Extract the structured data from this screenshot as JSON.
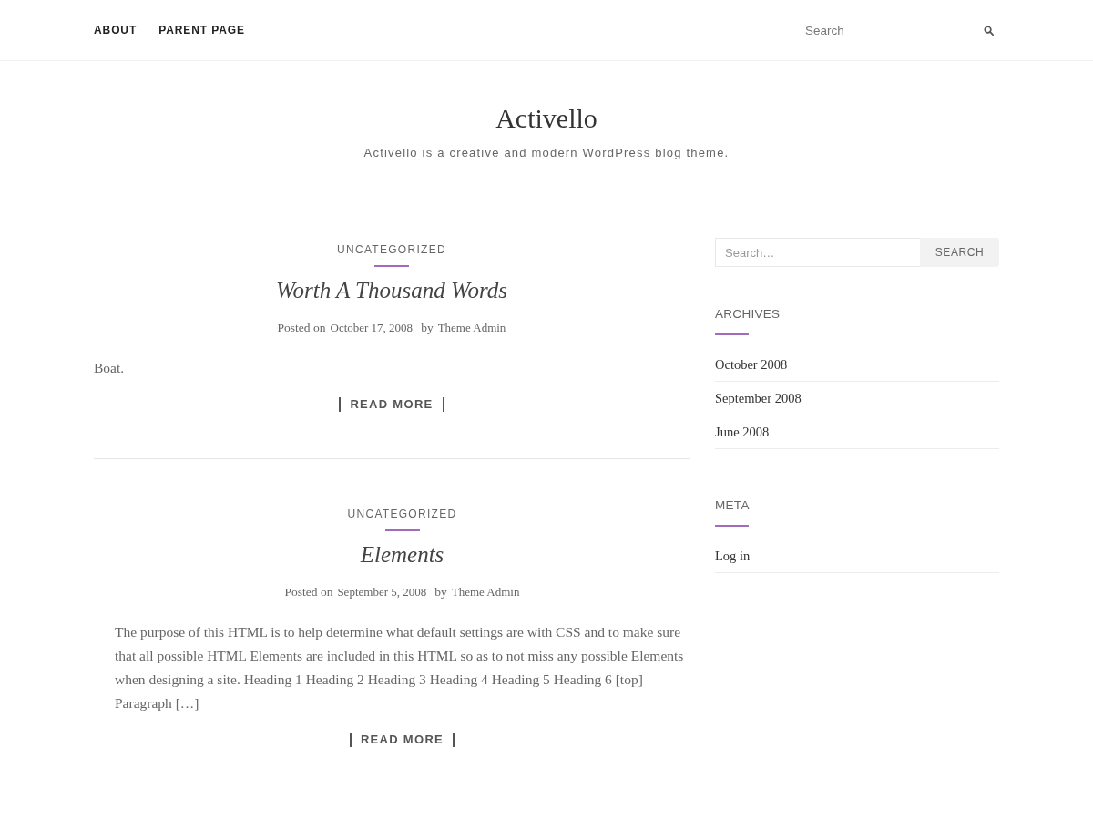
{
  "nav": {
    "items": [
      {
        "label": "ABOUT"
      },
      {
        "label": "PARENT PAGE"
      }
    ],
    "search": {
      "placeholder": "Search"
    }
  },
  "site": {
    "title": "Activello",
    "tagline": "Activello is a creative and modern WordPress blog theme."
  },
  "posts": [
    {
      "category": "UNCATEGORIZED",
      "title": "Worth A Thousand Words",
      "posted_label": "Posted on",
      "date": "October 17, 2008",
      "by_label": "by",
      "author": "Theme Admin",
      "excerpt": "Boat.",
      "read_more": "READ MORE"
    },
    {
      "category": "UNCATEGORIZED",
      "title": "Elements",
      "posted_label": "Posted on",
      "date": "September 5, 2008",
      "by_label": "by",
      "author": "Theme Admin",
      "excerpt": "The purpose of this HTML is to help determine what default settings are with CSS and to make sure that all possible HTML Elements are included in this HTML so as to not miss any possible Elements when designing a site. Heading 1 Heading 2 Heading 3 Heading 4 Heading 5 Heading 6 [top] Paragraph […]",
      "read_more": "READ MORE"
    }
  ],
  "sidebar": {
    "search": {
      "placeholder": "Search…",
      "button": "SEARCH"
    },
    "widgets": [
      {
        "title": "ARCHIVES",
        "links": [
          "October 2008",
          "September 2008",
          "June 2008"
        ]
      },
      {
        "title": "META",
        "links": [
          "Log in"
        ]
      }
    ]
  }
}
